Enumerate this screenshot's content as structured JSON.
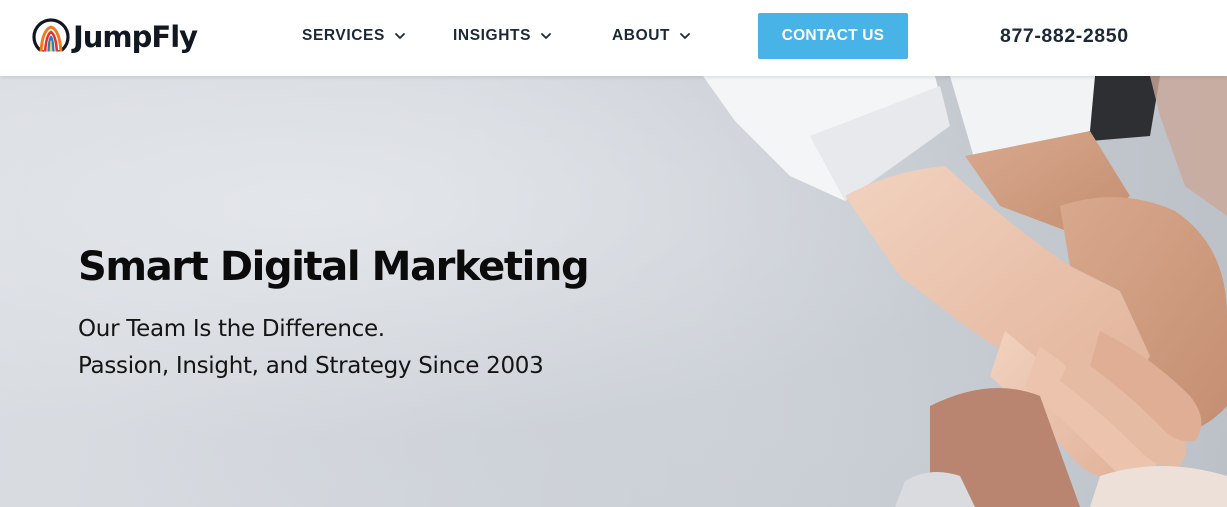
{
  "brand": {
    "name": "JumpFly",
    "colors": {
      "orange": "#f07b1f",
      "navy": "#111822",
      "text_dark": "#1b2838"
    },
    "logo_icon": "rainbow-arch-icon"
  },
  "nav": {
    "items": [
      {
        "label": "SERVICES",
        "icon": "chevron-down-icon"
      },
      {
        "label": "INSIGHTS",
        "icon": "chevron-down-icon"
      },
      {
        "label": "ABOUT",
        "icon": "chevron-down-icon"
      }
    ],
    "cta": {
      "label": "CONTACT US",
      "color": "#47b3e6"
    },
    "phone": "877-882-2850"
  },
  "hero": {
    "title": "Smart Digital Marketing",
    "subtitle_lines": [
      "Our Team Is the Difference.",
      "Passion, Insight, and Strategy Since 2003"
    ],
    "image": "stacked-hands-photo"
  }
}
